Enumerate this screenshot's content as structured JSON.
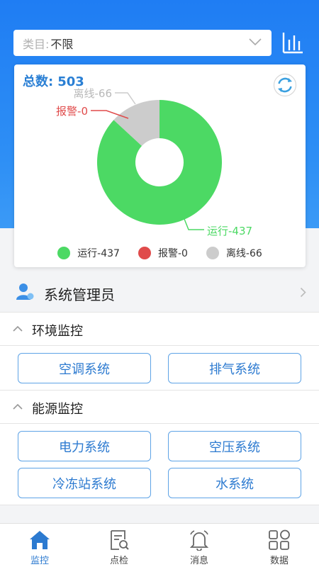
{
  "filter": {
    "label": "类目:",
    "value": "不限"
  },
  "summary": {
    "total_label": "总数:",
    "total_value": "503"
  },
  "chart_data": {
    "type": "pie",
    "categories": [
      "运行",
      "报警",
      "离线"
    ],
    "values": [
      437,
      0,
      66
    ],
    "colors": [
      "#4cd964",
      "#e04b4b",
      "#cccccc"
    ],
    "callouts": [
      "运行-437",
      "报警-0",
      "离线-66"
    ],
    "legend": [
      "运行-437",
      "报警-0",
      "离线-66"
    ],
    "legend_position": "bottom"
  },
  "user": {
    "name": "系统管理员"
  },
  "groups": [
    {
      "title": "环境监控",
      "buttons": [
        "空调系统",
        "排气系统"
      ]
    },
    {
      "title": "能源监控",
      "buttons": [
        "电力系统",
        "空压系统",
        "冷冻站系统",
        "水系统"
      ]
    }
  ],
  "tabs": [
    {
      "label": "监控",
      "icon": "home-icon",
      "active": true
    },
    {
      "label": "点检",
      "icon": "inspection-icon",
      "active": false
    },
    {
      "label": "消息",
      "icon": "bell-icon",
      "active": false
    },
    {
      "label": "数据",
      "icon": "grid-icon",
      "active": false
    }
  ],
  "colors": {
    "primary": "#2c7ad0",
    "header_blue": "#1f7df3",
    "running": "#4cd964",
    "alarm": "#e04b4b",
    "offline": "#cccccc"
  }
}
